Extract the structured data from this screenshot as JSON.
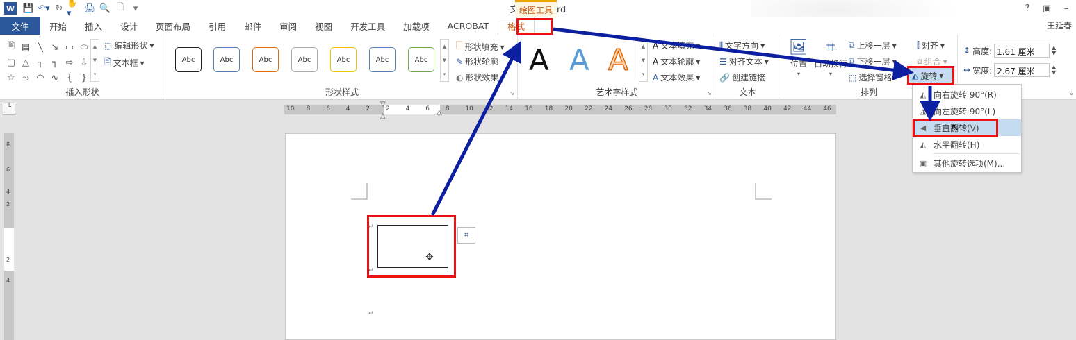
{
  "app": {
    "title": "文档1 - Word",
    "context_tab_label": "绘图工具",
    "user": "王延春",
    "logo": "W"
  },
  "qat": {
    "icons": [
      "save-icon",
      "undo-icon",
      "redo-icon",
      "touch-mode-icon",
      "print-preview-icon",
      "new-doc-icon",
      "customize-icon"
    ]
  },
  "tabs": [
    "文件",
    "开始",
    "插入",
    "设计",
    "页面布局",
    "引用",
    "邮件",
    "审阅",
    "视图",
    "开发工具",
    "加载项",
    "ACROBAT",
    "格式"
  ],
  "groups": {
    "insert_shapes": {
      "label": "插入形状",
      "edit_shape": "编辑形状",
      "text_box": "文本框"
    },
    "shape_styles": {
      "label": "形状样式",
      "sample": "Abc",
      "fill": "形状填充",
      "outline": "形状轮廓",
      "effects": "形状效果"
    },
    "wordart": {
      "label": "艺术字样式",
      "letter": "A",
      "text_fill": "文本填充",
      "text_outline": "文本轮廓",
      "text_effects": "文本效果"
    },
    "text": {
      "label": "文本",
      "direction": "文字方向",
      "align": "对齐文本",
      "link": "创建链接"
    },
    "arrange": {
      "label": "排列",
      "position": "位置",
      "wrap": "自动换行",
      "forward": "上移一层",
      "backward": "下移一层",
      "selection_pane": "选择窗格",
      "align": "对齐",
      "group": "组合",
      "rotate": "旋转"
    },
    "size": {
      "height_label": "高度:",
      "height_value": "1.61 厘米",
      "width_label": "宽度:",
      "width_value": "2.67 厘米"
    }
  },
  "rotate_menu": {
    "items": [
      "向右旋转 90°(R)",
      "向左旋转 90°(L)",
      "垂直翻转(V)",
      "水平翻转(H)",
      "其他旋转选项(M)..."
    ],
    "active_index": 2
  },
  "ruler": {
    "horizontal": [
      "10",
      "8",
      "6",
      "4",
      "2",
      "2",
      "4",
      "6",
      "8",
      "10",
      "12",
      "14",
      "16",
      "18",
      "20",
      "22",
      "24",
      "26",
      "28",
      "30",
      "32",
      "34",
      "36",
      "38",
      "40",
      "42",
      "44",
      "46"
    ],
    "vertical": [
      "8",
      "6",
      "4",
      "2",
      "2",
      "4"
    ]
  },
  "colors": {
    "word_blue": "#2b579a",
    "context_orange": "#c55a11",
    "highlight_red": "#e11111",
    "arrow_navy": "#0b1fa0"
  }
}
